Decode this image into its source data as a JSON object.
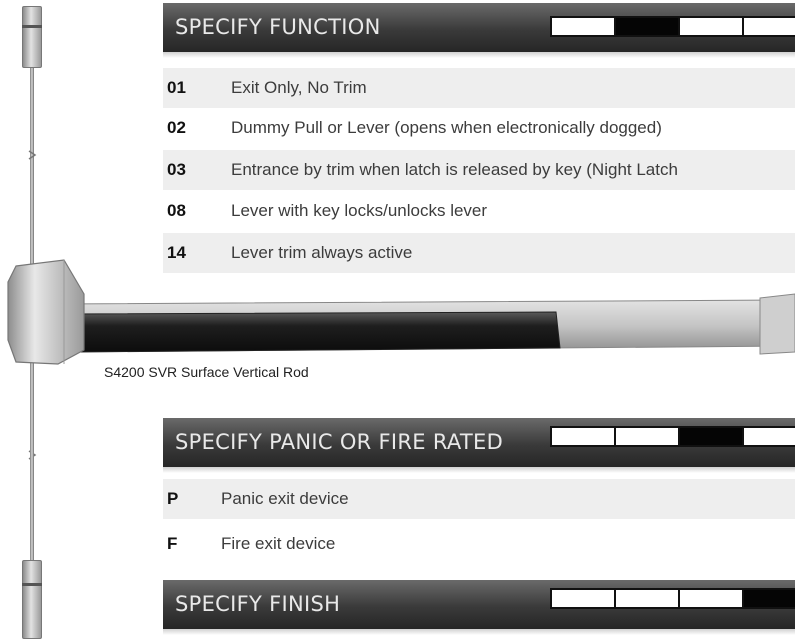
{
  "sections": {
    "function": {
      "title": "SPECIFY FUNCTION",
      "code_boxes": [
        false,
        true,
        false,
        false
      ],
      "options": [
        {
          "code": "01",
          "desc": "Exit Only, No Trim"
        },
        {
          "code": "02",
          "desc": "Dummy Pull or Lever (opens when electronically dogged)"
        },
        {
          "code": "03",
          "desc": "Entrance by trim when latch is released by key (Night Latch"
        },
        {
          "code": "08",
          "desc": "Lever with key locks/unlocks lever"
        },
        {
          "code": "14",
          "desc": "Lever trim always active"
        }
      ]
    },
    "panic_fire": {
      "title": "SPECIFY PANIC OR FIRE RATED",
      "code_boxes": [
        false,
        false,
        true,
        false
      ],
      "options": [
        {
          "code": "P",
          "desc": "Panic exit device"
        },
        {
          "code": "F",
          "desc": "Fire exit device"
        }
      ]
    },
    "finish": {
      "title": "SPECIFY FINISH",
      "code_boxes": [
        false,
        false,
        false,
        true
      ]
    }
  },
  "device": {
    "caption": "S4200 SVR Surface Vertical Rod"
  }
}
